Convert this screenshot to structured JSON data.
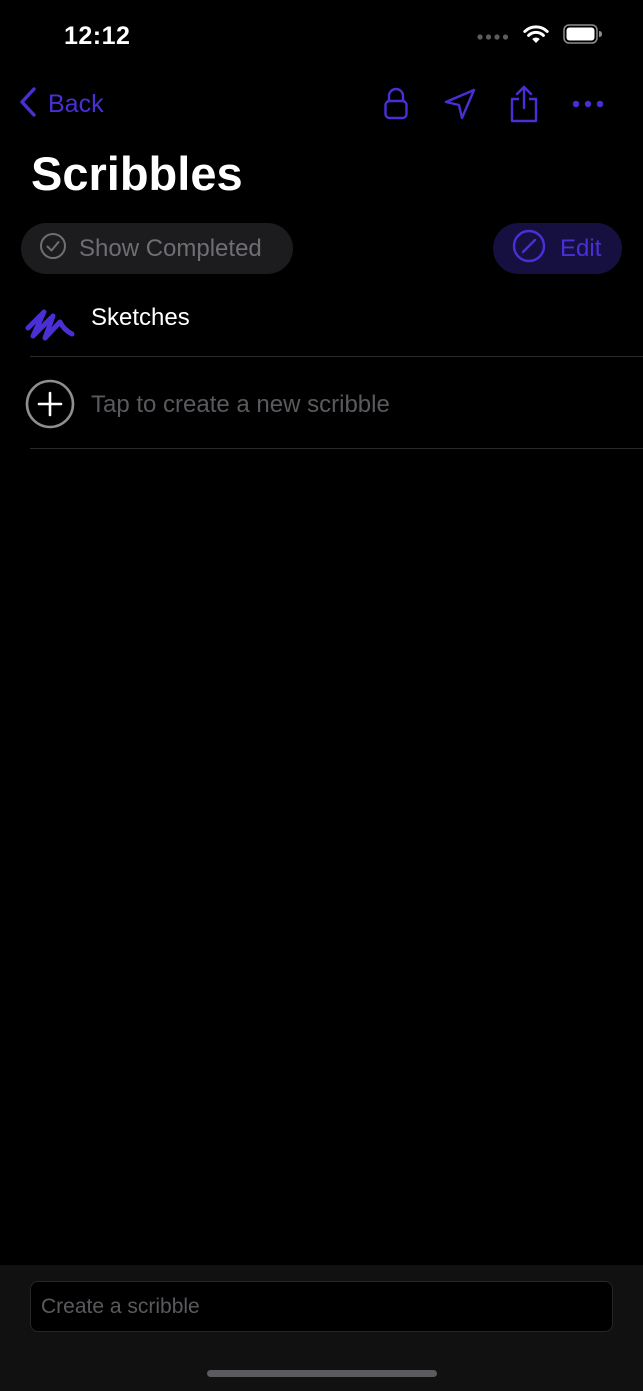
{
  "status_bar": {
    "time": "12:12",
    "icons": [
      "signal-dots-icon",
      "wifi-icon",
      "battery-icon"
    ]
  },
  "nav": {
    "back_label": "Back",
    "actions": [
      "lock-icon",
      "location-arrow-icon",
      "share-icon",
      "more-icon"
    ]
  },
  "page": {
    "title": "Scribbles"
  },
  "filters": {
    "show_completed_label": "Show Completed",
    "edit_label": "Edit"
  },
  "list": {
    "items": [
      {
        "label": "Sketches",
        "icon": "scribble-icon"
      }
    ],
    "new_item_label": "Tap to create a new scribble"
  },
  "bottom": {
    "input_placeholder": "Create a scribble",
    "input_value": ""
  },
  "colors": {
    "accent": "#4a2fd6",
    "background": "#000000",
    "pill": "#1c1c1e",
    "edit_pill": "#161040",
    "muted_text": "#6e6e73",
    "bottom_bar": "#111112"
  }
}
